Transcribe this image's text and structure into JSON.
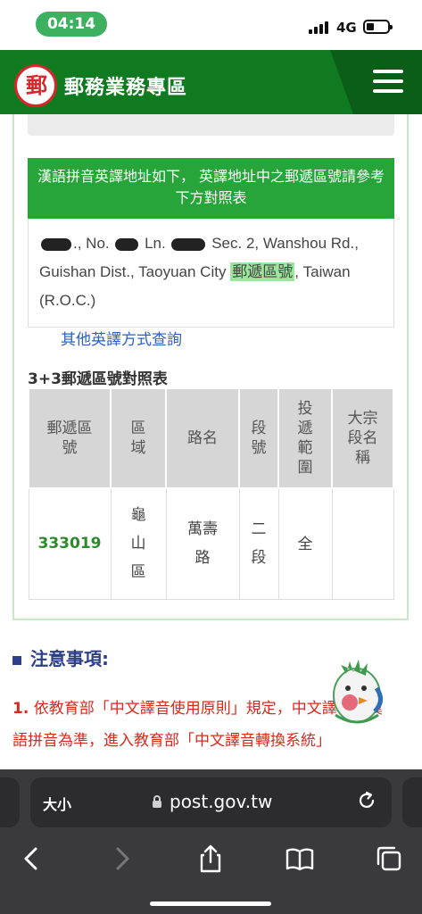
{
  "status_bar": {
    "time": "04:14",
    "network": "4G"
  },
  "header": {
    "logo_char": "郵",
    "title": "郵務業務專區"
  },
  "notice": {
    "text": "漢語拼音英譯地址如下， 英譯地址中之郵遞區號請參考下方對照表"
  },
  "address": {
    "part1": "., No.",
    "part2": "Ln.",
    "part3": "Sec. 2, Wanshou Rd., Guishan Dist., Taoyuan City",
    "zip_label": "郵遞區號",
    "part4": ", Taiwan (R.O.C.)"
  },
  "links": {
    "other_methods": "其他英譯方式查詢"
  },
  "zip_table": {
    "title": "3+3郵遞區號對照表",
    "headers": [
      "郵遞區號",
      "區域",
      "路名",
      "段號",
      "投遞範圍",
      "大宗段名稱"
    ],
    "rows": [
      {
        "zip": "333019",
        "area": "龜山區",
        "road": "萬壽路",
        "section": "二段",
        "range": "全",
        "bulk": ""
      }
    ]
  },
  "notes": {
    "heading": "注意事項:",
    "num": "1.",
    "text": "依教育部「中文譯音使用原則」規定，中文譯音以漢語拼音為準，進入教育部「中文譯音轉換系統」"
  },
  "browser": {
    "text_size_label": "大小",
    "url": "post.gov.tw"
  }
}
